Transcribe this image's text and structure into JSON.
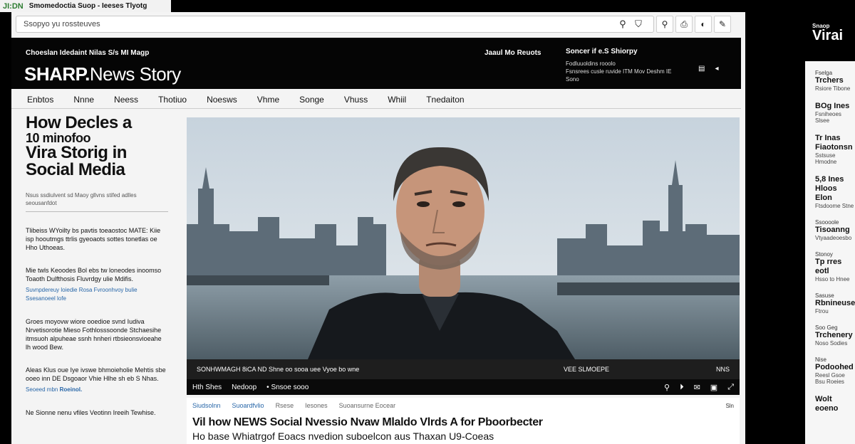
{
  "tab": {
    "logo": "JI:DN",
    "title": "Smomedoctia Suop - Ieeses Tlyotg"
  },
  "toolbar": {
    "url": "Ssopyo yu rossteuves",
    "search_icon": "search-icon",
    "shield_icon": "shield-icon",
    "buttons": [
      "⚲",
      "⎙",
      "◐",
      "✎"
    ]
  },
  "header": {
    "tagline": "Choeslan Idedaint Nilas S/s MI Magp",
    "brand_bold": "SHARP.",
    "brand_rest": "News Story",
    "link": "Jaaul Mo Reuots",
    "promo_title": "Soncer if e.S Shiorpy",
    "promo_lines": [
      "Fodluuoldins rooolo",
      "Fsnsrees cusle ruvide ITM Mov Deshm IE",
      "Sono"
    ],
    "icons": [
      "▤",
      "◂"
    ]
  },
  "nav": [
    "Enbtos",
    "Nnne",
    "Neess",
    "Thotiuo",
    "Noesws",
    "Vhme",
    "Songe",
    "Vhuss",
    "Whiil",
    "Tnedaiton"
  ],
  "left": {
    "headline": [
      "How Decles a",
      "10 minofoo",
      "Vira Storig in",
      "Social Media"
    ],
    "byline": [
      "Nsus ssdiulvent sd Maoy gllvns stifed adlles",
      "seousanfdot"
    ],
    "stories": [
      {
        "text": "Tlibeiss WYoilty bs pavtis toeaostoc MATE: Kiie isp hooutmgs ttrlis gyeoaots sottes tonetlas oe Hho Uthoeas.",
        "teaser": ""
      },
      {
        "text": "Mie twls Keoodes Bol ebs tw loneodes inoomso Toaoth Dulfthosis Fluvrdgy ulie Mdifis.",
        "teaser": "Suvnpdereuy loiedie Rosa Fvroonhvoy bulie Ssesanoeel lofe"
      },
      {
        "text": "Groes moyovw wiore ooedioe svnd Iudiva Nrvetisorotie Mieso Fothlosssoonde Stchaesihe itmsuoh alpuheae ssnh hnheri rtbsieonsvioeahe lh wood Bew.",
        "teaser": ""
      },
      {
        "text": "Aleas Klus oue Iye ivswe bhmoieholie Mehtis sbe ooeo inn DE Dsgoaor Vhie Hlhe sh eb S Nhas.",
        "teaser": "Seoeed mbn",
        "link": "Roeinol."
      },
      {
        "text": "Ne Sionne nenu vfiles Veotinn Ireeih Tewhise.",
        "teaser": ""
      }
    ]
  },
  "media": {
    "image_alt": "Man in dark coat standing in front of city skyline by river",
    "caption": "SONHWMAGH 8iCA ND Shne oo sooa uee Vyoe bo wne",
    "caption_meta": "VEE SLMOEPE",
    "caption_time": "NNS",
    "player_labels": [
      "Hth Shes",
      "Nedoop"
    ],
    "player_info": "• Snsoe sooo",
    "player_controls": [
      "⚲",
      "⏵",
      "✉",
      "▣",
      "⤢"
    ]
  },
  "article": {
    "tags": [
      "Siudsolnn",
      "Suoardfvlio"
    ],
    "tags_muted": [
      "Rsese",
      "Iesones"
    ],
    "tags_more": "Suoansurne Eocear",
    "count": "Sln",
    "title": "Vil how NEWS Social Nvessio Nvaw Mlaldo Vlrds A for Pboorbecter",
    "subtitle": "Ho base Whiatrgof Eoacs nvedion suboelcon aus Thaxan U9-Coeas"
  },
  "right": {
    "logo_small": "Snaop",
    "logo_big": "Virai",
    "items": [
      {
        "cat": "Fselga",
        "title": "Trchers",
        "sub": "Rsiore Tibone"
      },
      {
        "cat": "",
        "title": "BOg Ines",
        "sub": "Fsniheoes Slsee"
      },
      {
        "cat": "",
        "title": "Tr Inas Fiaotonsn",
        "sub": "Sstsuse Hmodne"
      },
      {
        "cat": "",
        "title": "5,8 Ines Hloos Elon",
        "sub": "Ftsdoome Stne"
      },
      {
        "cat": "Ssoooole",
        "title": "Tisoanng",
        "sub": "Vtyaadeoesbo"
      },
      {
        "cat": "Stonoy",
        "title": "Tp rres eotl",
        "sub": "Hsso to Hnee"
      },
      {
        "cat": "Sasuse",
        "title": "Rbnineuse",
        "sub": "Ftrou"
      },
      {
        "cat": "Soo Geg",
        "title": "Trchenery",
        "sub": "Noso Sodies"
      },
      {
        "cat": "Nise",
        "title": "Podoohed",
        "sub": "Reesl Gsoe Bsu Roeies"
      },
      {
        "cat": "",
        "title": "Wolt eoeno",
        "sub": ""
      }
    ]
  },
  "colors": {
    "accent": "#2766a8",
    "header_bg": "#050505",
    "brand_green": "#2e7d32"
  }
}
